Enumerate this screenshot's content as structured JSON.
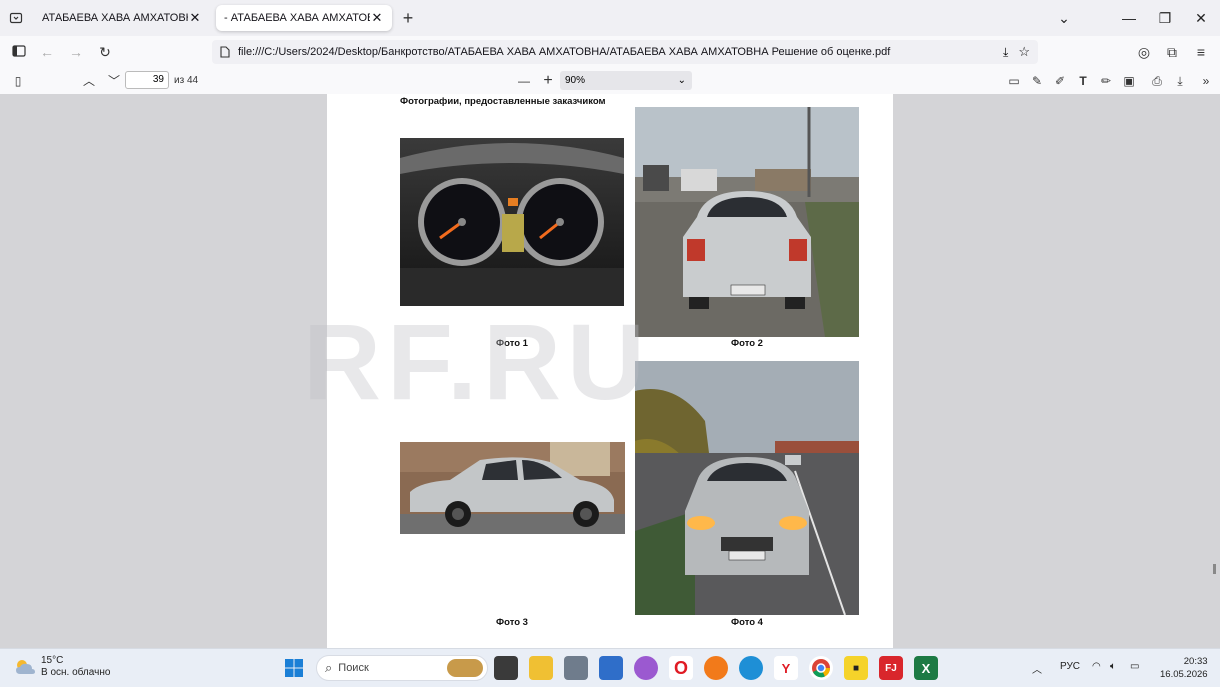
{
  "tabs": [
    {
      "title": "АТАБАЕВА ХАВА АМХАТОВНА Пол",
      "active": false
    },
    {
      "title": "- АТАБАЕВА ХАВА АМХАТОВНА Ре",
      "active": true
    }
  ],
  "nav": {
    "url": "file:///C:/Users/2024/Desktop/Банкротство/АТАБАЕВА ХАВА АМХАТОВНА/АТАБАЕВА ХАВА АМХАТОВНА Решение об оценке.pdf"
  },
  "pdf_toolbar": {
    "page_current": "39",
    "page_total": "из 44",
    "zoom": "90%"
  },
  "document": {
    "heading": "Фотографии, предоставленные заказчиком",
    "watermark": "RF.RU",
    "photos": [
      {
        "caption": "Фото 1",
        "subject": "dashboard"
      },
      {
        "caption": "Фото 2",
        "subject": "car-rear"
      },
      {
        "caption": "Фото 3",
        "subject": "car-side"
      },
      {
        "caption": "Фото 4",
        "subject": "car-front"
      }
    ]
  },
  "taskbar": {
    "weather_temp": "15°C",
    "weather_desc": "В осн. облачно",
    "search_placeholder": "Поиск",
    "language": "РУС",
    "time": "20:33",
    "date": "16.05.2026"
  }
}
